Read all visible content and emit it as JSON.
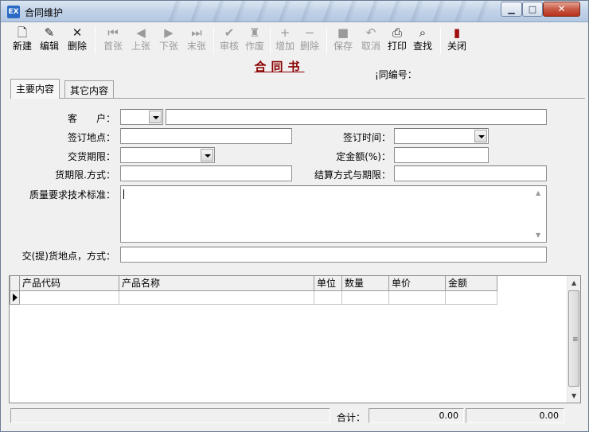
{
  "window": {
    "title": "合同维护",
    "app_icon_text": "EX",
    "min_icon": "▁",
    "max_icon": "□",
    "close_icon": "✕"
  },
  "toolbar": {
    "items": [
      {
        "label": "新建",
        "icon": "new-doc-icon",
        "glyph": "🗋",
        "enabled": true
      },
      {
        "label": "编辑",
        "icon": "edit-icon",
        "glyph": "✎",
        "enabled": true
      },
      {
        "label": "删除",
        "icon": "delete-icon",
        "glyph": "✕",
        "enabled": true
      },
      {
        "label": "首张",
        "icon": "first-icon",
        "glyph": "⏮",
        "enabled": false
      },
      {
        "label": "上张",
        "icon": "prev-icon",
        "glyph": "◀",
        "enabled": false
      },
      {
        "label": "下张",
        "icon": "next-icon",
        "glyph": "▶",
        "enabled": false
      },
      {
        "label": "末张",
        "icon": "last-icon",
        "glyph": "⏭",
        "enabled": false
      },
      {
        "label": "审核",
        "icon": "approve-icon",
        "glyph": "✔",
        "enabled": false
      },
      {
        "label": "作废",
        "icon": "void-icon",
        "glyph": "♜",
        "enabled": false
      },
      {
        "label": "增加",
        "icon": "add-row-icon",
        "glyph": "+",
        "enabled": false
      },
      {
        "label": "删除",
        "icon": "remove-row-icon",
        "glyph": "−",
        "enabled": false
      },
      {
        "label": "保存",
        "icon": "save-icon",
        "glyph": "■",
        "enabled": false
      },
      {
        "label": "取消",
        "icon": "undo-icon",
        "glyph": "↶",
        "enabled": false
      },
      {
        "label": "打印",
        "icon": "print-icon",
        "glyph": "⎙",
        "enabled": true
      },
      {
        "label": "查找",
        "icon": "find-icon",
        "glyph": "⌕",
        "enabled": true
      },
      {
        "label": "关闭",
        "icon": "exit-icon",
        "glyph": "▮",
        "enabled": true
      }
    ]
  },
  "header": {
    "doc_title": "合同书",
    "contract_no_label": "¡同编号："
  },
  "tabs": [
    {
      "label": "主要内容",
      "active": true
    },
    {
      "label": "其它内容",
      "active": false
    }
  ],
  "form": {
    "customer_label": "客　　户：",
    "sign_place_label": "签订地点：",
    "sign_time_label": "签订时间：",
    "delivery_period_label": "交货期限：",
    "deposit_label": "定金额(%)：",
    "period_method_label": "货期限.方式：",
    "settlement_label": "结算方式与期限：",
    "quality_label": "质量要求技术标准：",
    "delivery_place_label": "交(提)货地点，方式：",
    "customer_code": "",
    "customer_name": "",
    "sign_place": "",
    "sign_time": "",
    "delivery_period": "",
    "deposit": "",
    "period_method": "",
    "settlement": "",
    "quality": "",
    "delivery_place": ""
  },
  "grid": {
    "columns": [
      "产品代码",
      "产品名称",
      "单位",
      "数量",
      "单价",
      "金额"
    ],
    "rows": [
      [
        "",
        "",
        "",
        "",
        "",
        ""
      ]
    ]
  },
  "status": {
    "left": "",
    "total_label": "合计：",
    "total_qty": "0.00",
    "total_amount": "0.00"
  }
}
